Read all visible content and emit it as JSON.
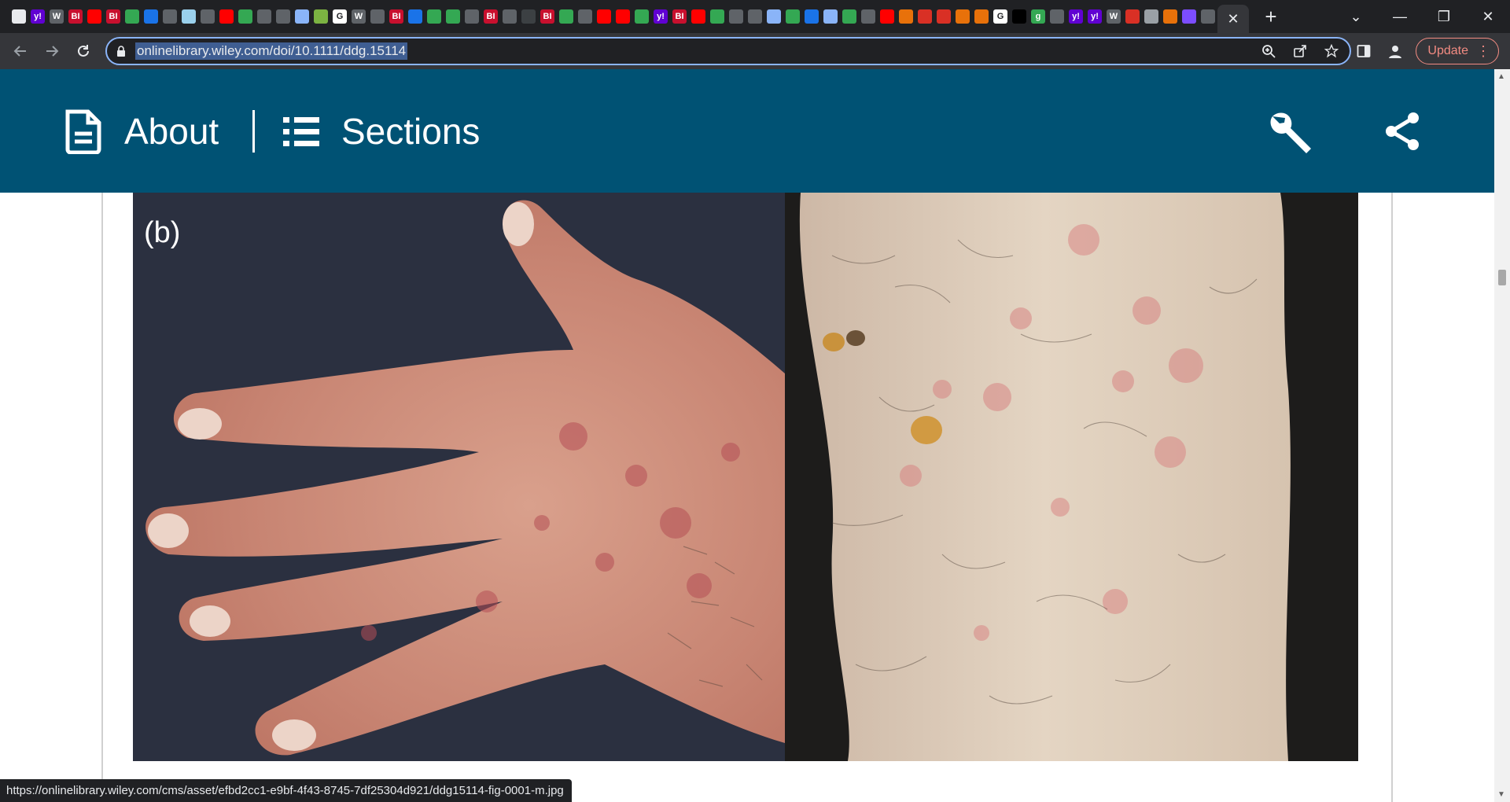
{
  "browser": {
    "tabs": [
      {
        "icon": "chrome-icon",
        "color": "#e8eaed",
        "glyph": ""
      },
      {
        "icon": "yahoo-icon",
        "color": "#6001d2",
        "glyph": "y!"
      },
      {
        "icon": "wsj-icon",
        "color": "#5f6368",
        "glyph": "W"
      },
      {
        "icon": "business-insider-icon",
        "color": "#c8102e",
        "glyph": "BI"
      },
      {
        "icon": "youtube-icon",
        "color": "#ff0000",
        "glyph": ""
      },
      {
        "icon": "business-insider-icon",
        "color": "#c8102e",
        "glyph": "BI"
      },
      {
        "icon": "play-icon",
        "color": "#34a853",
        "glyph": ""
      },
      {
        "icon": "site-icon",
        "color": "#1a73e8",
        "glyph": ""
      },
      {
        "icon": "site-icon",
        "color": "#5f6368",
        "glyph": ""
      },
      {
        "icon": "site-icon",
        "color": "#9ad0ec",
        "glyph": ""
      },
      {
        "icon": "globe-icon",
        "color": "#5f6368",
        "glyph": ""
      },
      {
        "icon": "youtube-icon",
        "color": "#ff0000",
        "glyph": ""
      },
      {
        "icon": "play-icon",
        "color": "#34a853",
        "glyph": ""
      },
      {
        "icon": "globe-icon",
        "color": "#5f6368",
        "glyph": ""
      },
      {
        "icon": "site-icon",
        "color": "#5f6368",
        "glyph": ""
      },
      {
        "icon": "search-icon",
        "color": "#8ab4f8",
        "glyph": ""
      },
      {
        "icon": "site-icon",
        "color": "#7cb342",
        "glyph": ""
      },
      {
        "icon": "google-icon",
        "color": "#ffffff",
        "glyph": "G"
      },
      {
        "icon": "wsj-icon",
        "color": "#5f6368",
        "glyph": "W"
      },
      {
        "icon": "globe-icon",
        "color": "#5f6368",
        "glyph": ""
      },
      {
        "icon": "business-insider-icon",
        "color": "#c8102e",
        "glyph": "BI"
      },
      {
        "icon": "site-icon",
        "color": "#1a73e8",
        "glyph": ""
      },
      {
        "icon": "play-icon",
        "color": "#34a853",
        "glyph": ""
      },
      {
        "icon": "play-icon",
        "color": "#34a853",
        "glyph": ""
      },
      {
        "icon": "site-icon",
        "color": "#5f6368",
        "glyph": ""
      },
      {
        "icon": "business-insider-icon",
        "color": "#c8102e",
        "glyph": "BI"
      },
      {
        "icon": "globe-icon",
        "color": "#5f6368",
        "glyph": ""
      },
      {
        "icon": "site-icon",
        "color": "#3c4043",
        "glyph": ""
      },
      {
        "icon": "business-insider-icon",
        "color": "#c8102e",
        "glyph": "BI"
      },
      {
        "icon": "play-icon",
        "color": "#34a853",
        "glyph": ""
      },
      {
        "icon": "site-icon",
        "color": "#5f6368",
        "glyph": ""
      },
      {
        "icon": "youtube-icon",
        "color": "#ff0000",
        "glyph": ""
      },
      {
        "icon": "youtube-icon",
        "color": "#ff0000",
        "glyph": ""
      },
      {
        "icon": "play-icon",
        "color": "#34a853",
        "glyph": ""
      },
      {
        "icon": "yahoo-icon",
        "color": "#6001d2",
        "glyph": "y!"
      },
      {
        "icon": "business-insider-icon",
        "color": "#c8102e",
        "glyph": "BI"
      },
      {
        "icon": "youtube-icon",
        "color": "#ff0000",
        "glyph": ""
      },
      {
        "icon": "play-icon",
        "color": "#34a853",
        "glyph": ""
      },
      {
        "icon": "globe-icon",
        "color": "#5f6368",
        "glyph": ""
      },
      {
        "icon": "globe-icon",
        "color": "#5f6368",
        "glyph": ""
      },
      {
        "icon": "search-icon",
        "color": "#8ab4f8",
        "glyph": ""
      },
      {
        "icon": "play-icon",
        "color": "#34a853",
        "glyph": ""
      },
      {
        "icon": "site-icon",
        "color": "#1a73e8",
        "glyph": ""
      },
      {
        "icon": "search-icon",
        "color": "#8ab4f8",
        "glyph": ""
      },
      {
        "icon": "play-icon",
        "color": "#34a853",
        "glyph": ""
      },
      {
        "icon": "site-icon",
        "color": "#5f6368",
        "glyph": ""
      },
      {
        "icon": "youtube-icon",
        "color": "#ff0000",
        "glyph": ""
      },
      {
        "icon": "bookmark-icon",
        "color": "#e8710a",
        "glyph": ""
      },
      {
        "icon": "red-pin-icon",
        "color": "#d93025",
        "glyph": ""
      },
      {
        "icon": "red-pin-icon",
        "color": "#d93025",
        "glyph": ""
      },
      {
        "icon": "bookmark-icon",
        "color": "#e8710a",
        "glyph": ""
      },
      {
        "icon": "bookmark-icon",
        "color": "#e8710a",
        "glyph": ""
      },
      {
        "icon": "google-icon",
        "color": "#ffffff",
        "glyph": "G"
      },
      {
        "icon": "site-icon",
        "color": "#000000",
        "glyph": ""
      },
      {
        "icon": "site-icon",
        "color": "#34a853",
        "glyph": "g"
      },
      {
        "icon": "globe-icon",
        "color": "#5f6368",
        "glyph": ""
      },
      {
        "icon": "yahoo-icon",
        "color": "#6001d2",
        "glyph": "y!"
      },
      {
        "icon": "yahoo-icon",
        "color": "#6001d2",
        "glyph": "y!"
      },
      {
        "icon": "wsj-icon",
        "color": "#5f6368",
        "glyph": "W"
      },
      {
        "icon": "red-pin-icon",
        "color": "#d93025",
        "glyph": ""
      },
      {
        "icon": "site-icon",
        "color": "#9aa0a6",
        "glyph": ""
      },
      {
        "icon": "bookmark-icon",
        "color": "#e8710a",
        "glyph": ""
      },
      {
        "icon": "site-icon",
        "color": "#7c4dff",
        "glyph": ""
      },
      {
        "icon": "site-icon",
        "color": "#5f6368",
        "glyph": ""
      }
    ],
    "url": "onlinelibrary.wiley.com/doi/10.1111/ddg.15114",
    "update_label": "Update",
    "status_url": "https://onlinelibrary.wiley.com/cms/asset/efbd2cc1-e9bf-4f43-8745-7df25304d921/ddg15114-fig-0001-m.jpg"
  },
  "header": {
    "about_label": "About",
    "sections_label": "Sections",
    "bg_color": "#005274"
  },
  "figure": {
    "panel_label": "(b)"
  }
}
